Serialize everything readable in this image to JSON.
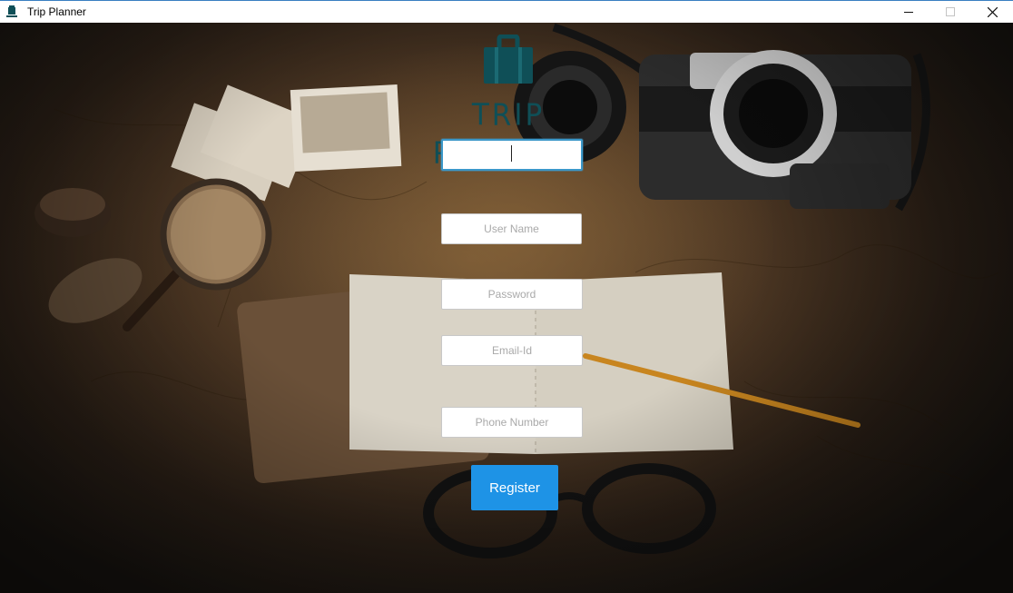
{
  "window": {
    "title": "Trip Planner",
    "controls": {
      "minimize": "—",
      "maximize": "☐",
      "close": "✕"
    }
  },
  "logo": {
    "text": "TRIP PLANNER",
    "icon": "suitcase-icon",
    "color": "#0f4f57"
  },
  "form": {
    "first_field": {
      "value": "",
      "placeholder": ""
    },
    "username": {
      "placeholder": "User Name"
    },
    "password": {
      "placeholder": "Password"
    },
    "email": {
      "placeholder": "Email-Id"
    },
    "phone": {
      "placeholder": "Phone Number"
    },
    "register_label": "Register"
  },
  "colors": {
    "accent": "#1e93e6",
    "focus_border": "#3c98c9"
  }
}
